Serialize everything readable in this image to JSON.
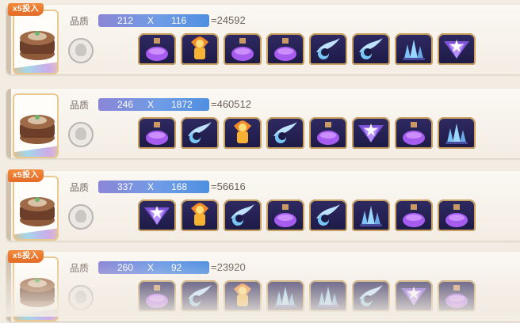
{
  "rows": [
    {
      "badge": "x5投入",
      "label": "品质",
      "a": "212",
      "x": "X",
      "b": "116",
      "result": "=24592",
      "items": [
        "purple-potion",
        "orange-potion",
        "purple-potion",
        "purple-potion",
        "moon-icon",
        "moon-icon",
        "crystal-cluster",
        "feather-fan"
      ]
    },
    {
      "badge": "",
      "label": "品质",
      "a": "246",
      "x": "X",
      "b": "1872",
      "result": "=460512",
      "items": [
        "purple-potion",
        "moon-icon",
        "orange-potion",
        "moon-icon",
        "purple-potion",
        "feather-fan",
        "purple-potion",
        "crystal-cluster"
      ]
    },
    {
      "badge": "x5投入",
      "label": "品质",
      "a": "337",
      "x": "X",
      "b": "168",
      "result": "=56616",
      "items": [
        "feather-fan",
        "orange-potion",
        "moon-icon",
        "purple-potion",
        "moon-icon",
        "crystal-cluster",
        "purple-potion",
        "purple-potion"
      ]
    },
    {
      "badge": "x5投入",
      "label": "品质",
      "a": "260",
      "x": "X",
      "b": "92",
      "result": "=23920",
      "items": [
        "purple-potion",
        "moon-icon",
        "orange-potion",
        "crystal-cluster",
        "crystal-cluster",
        "moon-icon",
        "feather-fan",
        "purple-potion"
      ]
    }
  ],
  "colors": {
    "badge": "#e46a26",
    "bar_left": "#8b86d6",
    "bar_right": "#4f8fe0",
    "tile": "#1d1a45",
    "gold": "#c9a25f"
  }
}
